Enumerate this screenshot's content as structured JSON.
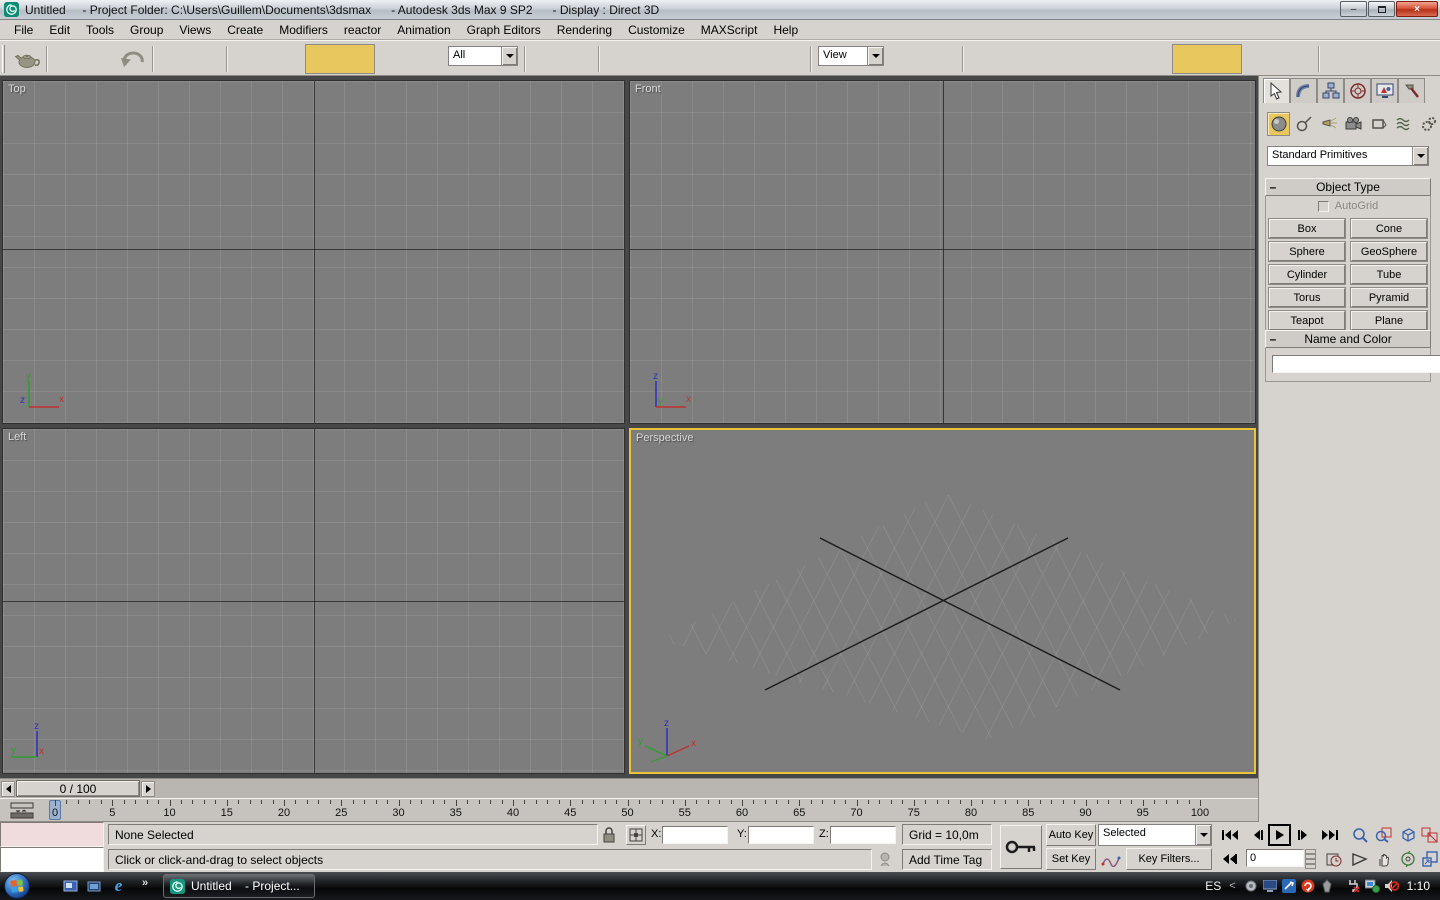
{
  "window": {
    "title": "Untitled     - Project Folder: C:\\Users\\Guillem\\Documents\\3dsmax      - Autodesk 3ds Max 9 SP2      - Display : Direct 3D",
    "minimize": "–",
    "close": "×"
  },
  "menu": {
    "items": [
      "File",
      "Edit",
      "Tools",
      "Group",
      "Views",
      "Create",
      "Modifiers",
      "reactor",
      "Animation",
      "Graph Editors",
      "Rendering",
      "Customize",
      "MAXScript",
      "Help"
    ]
  },
  "toolbar": {
    "filter_dropdown": "All",
    "view_dropdown": "View",
    "highlight_color": "#e9c75f"
  },
  "viewports": {
    "top_label": "Top",
    "front_label": "Front",
    "left_label": "Left",
    "perspective_label": "Perspective",
    "axis": {
      "x": "x",
      "y": "y",
      "z": "z"
    }
  },
  "command_panel": {
    "category_dropdown": "Standard Primitives",
    "object_type": {
      "title": "Object Type",
      "autogrid_label": "AutoGrid",
      "buttons": [
        "Box",
        "Cone",
        "Sphere",
        "GeoSphere",
        "Cylinder",
        "Tube",
        "Torus",
        "Pyramid",
        "Teapot",
        "Plane"
      ]
    },
    "name_and_color": {
      "title": "Name and Color",
      "name_value": "",
      "swatch_color": "#a61045"
    }
  },
  "timeline": {
    "slider_value": "0 / 100",
    "tick_start": 0,
    "tick_end": 100,
    "tick_step": 5,
    "current_frame": 0
  },
  "status_bar": {
    "selection_status": "None Selected",
    "prompt": "Click or click-and-drag to select objects",
    "x_label": "X:",
    "y_label": "Y:",
    "z_label": "Z:",
    "x_value": "",
    "y_value": "",
    "z_value": "",
    "grid_size": "Grid = 10,0m",
    "add_time_tag": "Add Time Tag",
    "auto_key_label": "Auto Key",
    "set_key_label": "Set Key",
    "key_mode_dropdown": "Selected",
    "key_filters_label": "Key Filters...",
    "frame_number": "0"
  },
  "taskbar": {
    "task_button": "Untitled    - Project...",
    "overflow_chevron": "»",
    "tray_chevron": "<",
    "language": "ES",
    "clock": "1:10"
  }
}
